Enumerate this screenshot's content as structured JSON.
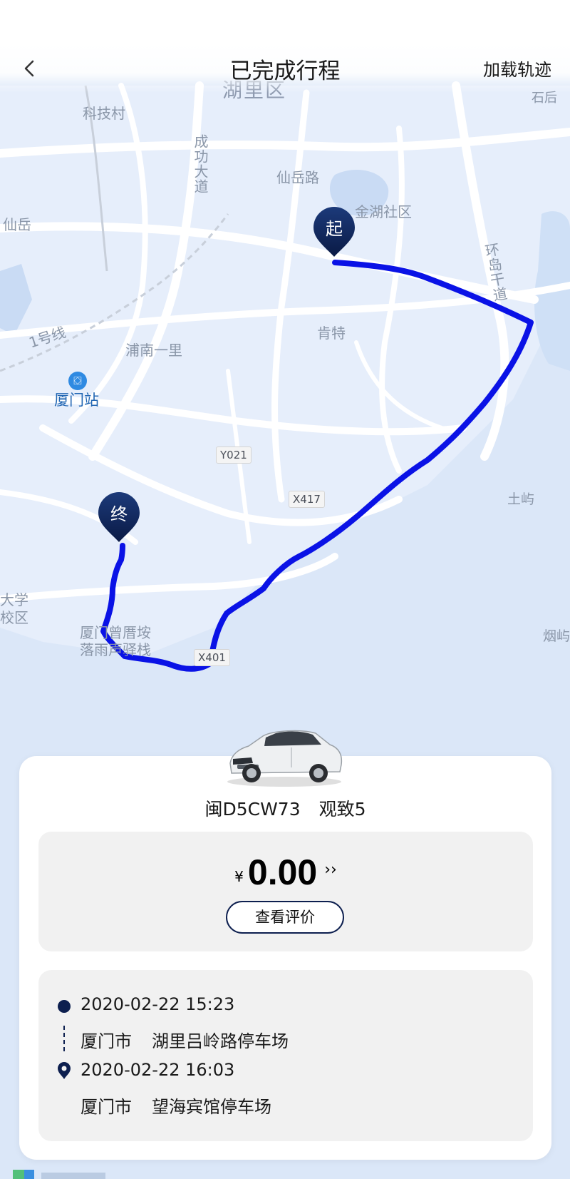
{
  "header": {
    "back_icon": "chevron-left-icon",
    "title": "已完成行程",
    "action_label": "加载轨迹"
  },
  "map": {
    "district": "湖里区",
    "labels": {
      "kejicun": "科技村",
      "chenggong": "成功大道",
      "xianyue_road": "仙岳路",
      "jinhu": "金湖社区",
      "xianyue": "仙岳",
      "huandao": "环岛干道",
      "shishi": "石后",
      "line1": "1号线",
      "kent": "肯特",
      "punan": "浦南一里",
      "xiamen_station": "厦门站",
      "university": "大学",
      "campus": "校区",
      "tuyu": "土屿",
      "yanyu": "烟屿",
      "zengcuoan_1": "厦门曾厝垵",
      "zengcuoan_2": "落雨声驿栈"
    },
    "roads": {
      "y021": "Y021",
      "x417": "X417",
      "x401": "X401"
    },
    "start_pin": "起",
    "end_pin": "终",
    "route_color": "#0a12e6",
    "pin_color": "#0d1f4f"
  },
  "trip": {
    "plate": "闽D5CW73",
    "model": "观致5",
    "currency": "¥",
    "amount": "0.00",
    "review_label": "查看评价",
    "start_time": "2020-02-22 15:23",
    "start_city": "厦门市",
    "start_place": "湖里吕岭路停车场",
    "end_time": "2020-02-22 16:03",
    "end_city": "厦门市",
    "end_place": "望海宾馆停车场"
  }
}
